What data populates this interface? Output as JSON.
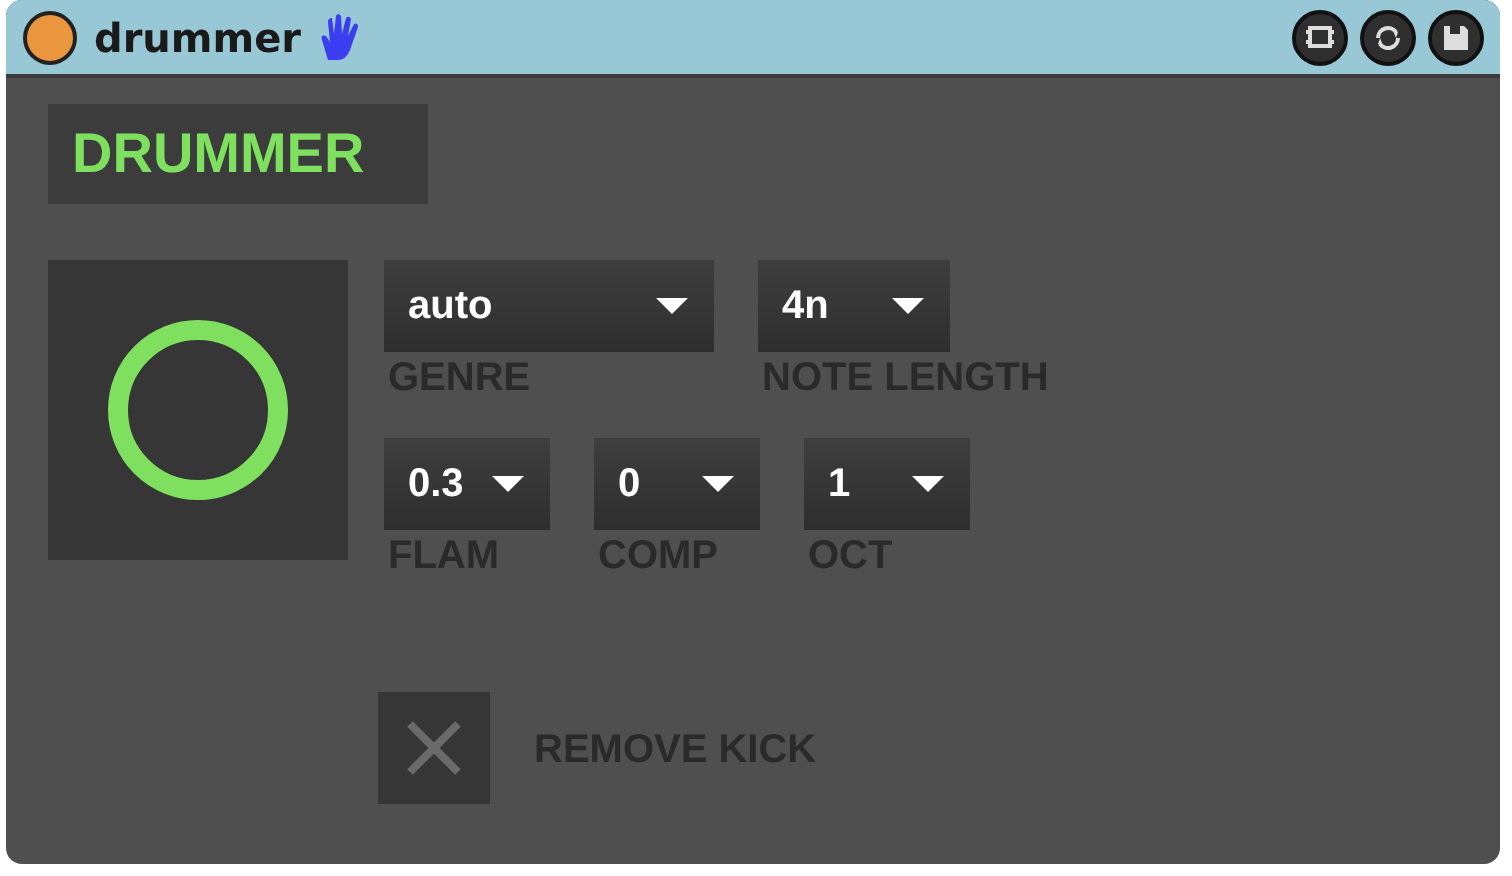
{
  "window": {
    "title": "drummer"
  },
  "heading": "DRUMMER",
  "rows": [
    [
      {
        "value": "auto",
        "label": "GENRE"
      },
      {
        "value": "4n",
        "label": "NOTE LENGTH"
      }
    ],
    [
      {
        "value": "0.3",
        "label": "FLAM"
      },
      {
        "value": "0",
        "label": "COMP"
      },
      {
        "value": "1",
        "label": "OCT"
      }
    ]
  ],
  "checkbox": {
    "label": "REMOVE KICK",
    "checked": true
  }
}
